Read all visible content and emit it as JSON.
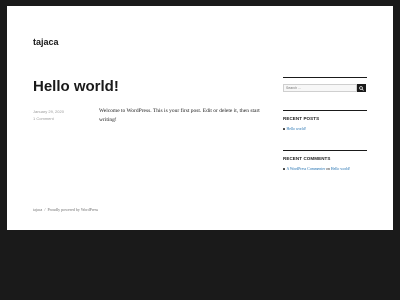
{
  "site": {
    "title": "tajaca"
  },
  "post": {
    "title": "Hello world!",
    "date": "January 29, 2020",
    "comments": "1 Comment",
    "content": "Welcome to WordPress. This is your first post. Edit or delete it, then start writing!"
  },
  "sidebar": {
    "search": {
      "placeholder": "Search ..."
    },
    "recent_posts": {
      "title": "RECENT POSTS",
      "items": [
        "Hello world!"
      ]
    },
    "recent_comments": {
      "title": "RECENT COMMENTS",
      "author": "A WordPress Commenter",
      "on": "on",
      "post": "Hello world!"
    }
  },
  "footer": {
    "site": "tajaca",
    "separator": "/",
    "credit": "Proudly powered by WordPress"
  }
}
